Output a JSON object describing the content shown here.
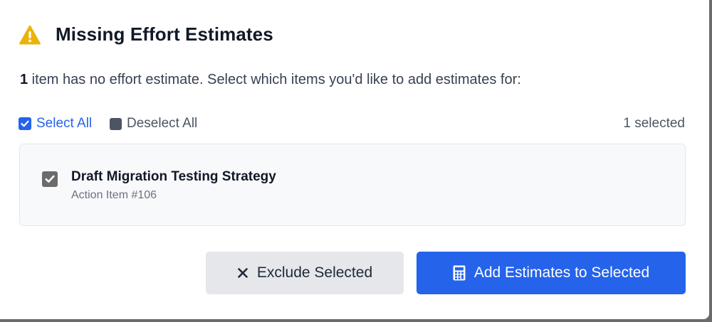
{
  "dialog": {
    "title": "Missing Effort Estimates",
    "icon": "warning-icon",
    "description_count": "1",
    "description_text": " item has no effort estimate. Select which items you'd like to add estimates for:"
  },
  "selection": {
    "select_all_label": "Select All",
    "deselect_all_label": "Deselect All",
    "selected_count_label": "1 selected"
  },
  "items": [
    {
      "title": "Draft Migration Testing Strategy",
      "subtitle": "Action Item #106",
      "checked": true
    }
  ],
  "actions": {
    "exclude_label": "Exclude Selected",
    "add_label": "Add Estimates to Selected"
  },
  "colors": {
    "accent": "#2563eb",
    "warning": "#eab308",
    "secondary_button": "#e5e7eb"
  }
}
